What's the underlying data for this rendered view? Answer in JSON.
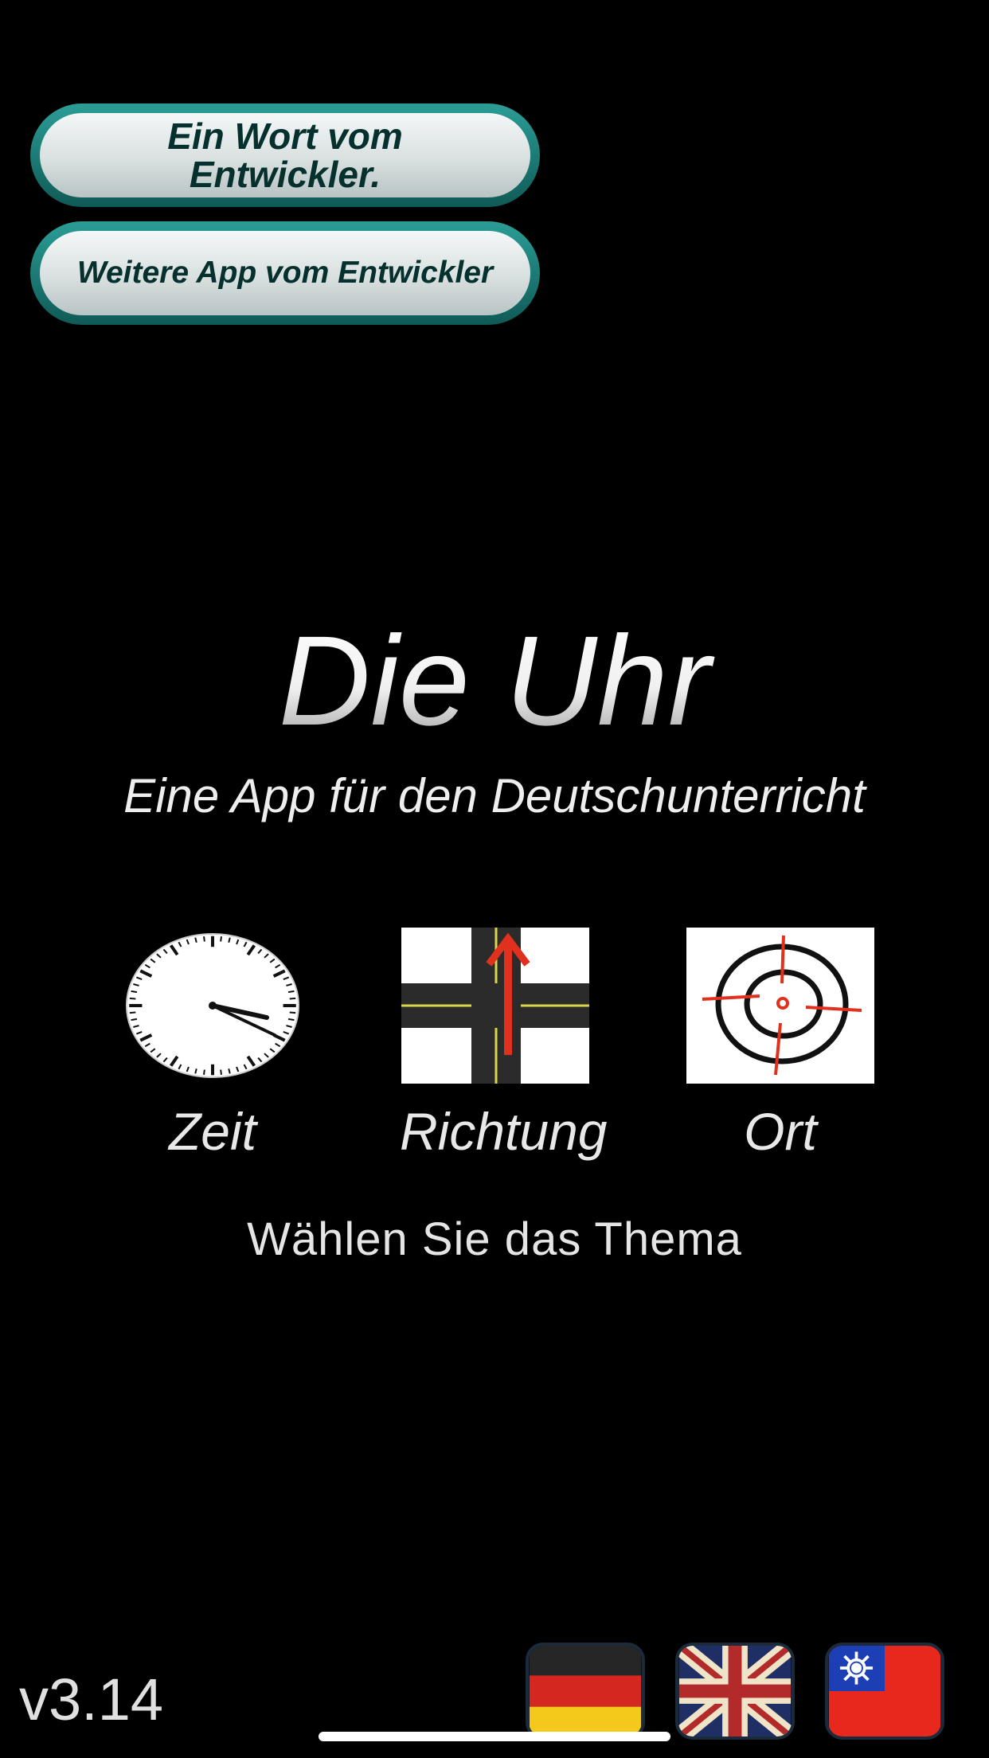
{
  "buttons": {
    "word_line1": "Ein Wort vom",
    "word_line2": "Entwickler.",
    "more_apps": "Weitere App vom Entwickler"
  },
  "title": "Die Uhr",
  "subtitle": "Eine App für den Deutschunterricht",
  "topics": [
    {
      "label": "Zeit",
      "icon": "clock-icon"
    },
    {
      "label": "Richtung",
      "icon": "crossroad-icon"
    },
    {
      "label": "Ort",
      "icon": "target-icon"
    }
  ],
  "prompt": "Wählen Sie das Thema",
  "version": "v3.14",
  "languages": [
    {
      "icon": "flag-germany-icon"
    },
    {
      "icon": "flag-uk-icon"
    },
    {
      "icon": "flag-taiwan-icon"
    }
  ],
  "colors": {
    "background": "#000000",
    "button_ring": "#1f7f79",
    "button_text": "#05302d"
  }
}
